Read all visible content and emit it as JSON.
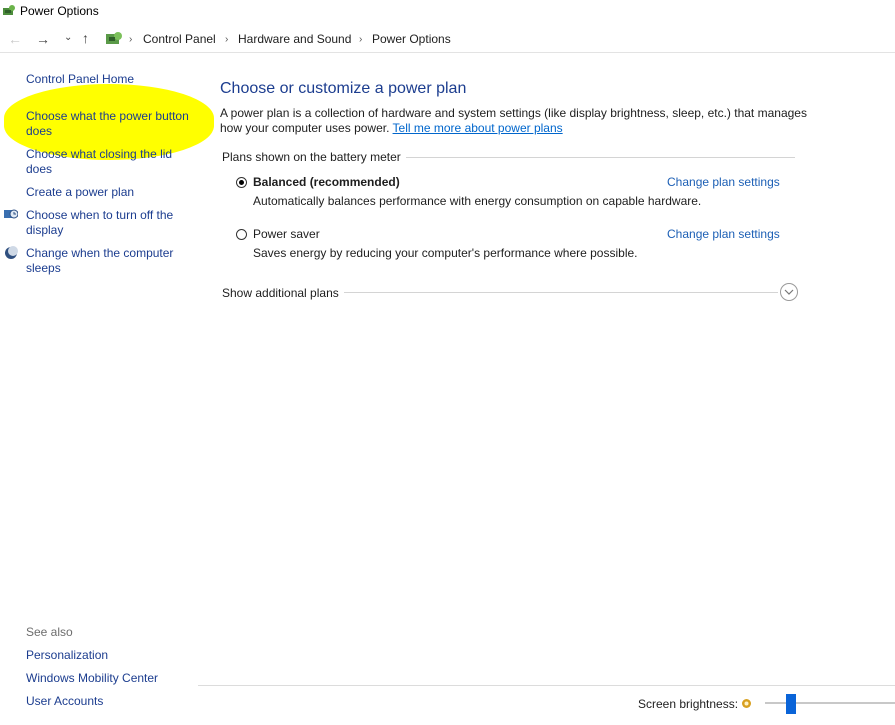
{
  "window": {
    "title": "Power Options"
  },
  "navbar": {
    "breadcrumbs": [
      "Control Panel",
      "Hardware and Sound",
      "Power Options"
    ],
    "sep": "›"
  },
  "left_pane": {
    "home": "Control Panel Home",
    "tasks": [
      {
        "label_line1": "Choose what the power button",
        "label_line2": "does"
      },
      {
        "label_line1": "Choose what closing the lid",
        "label_line2": "does"
      },
      {
        "label_line1": "Create a power plan",
        "label_line2": ""
      },
      {
        "label_line1": "Choose when to turn off the",
        "label_line2": "display"
      },
      {
        "label_line1": "Change when the computer",
        "label_line2": "sleeps"
      }
    ],
    "see_also": {
      "header": "See also",
      "links": [
        "Personalization",
        "Windows Mobility Center",
        "User Accounts"
      ]
    }
  },
  "main": {
    "title": "Choose or customize a power plan",
    "intro_text": "A power plan is a collection of hardware and system settings (like display brightness, sleep, etc.) that manages how your computer uses power. ",
    "intro_link": "Tell me more about power plans",
    "group_header": "Plans shown on the battery meter",
    "plans": [
      {
        "name": "Balanced (recommended)",
        "description": "Automatically balances performance with energy consumption on capable hardware.",
        "selected": true,
        "change_link": "Change plan settings"
      },
      {
        "name": "Power saver",
        "description": "Saves energy by reducing your computer's performance where possible.",
        "selected": false,
        "change_link": "Change plan settings"
      }
    ],
    "additional_plans": "Show additional plans"
  },
  "footer": {
    "brightness_label": "Screen brightness:",
    "brightness_level": 0.2
  },
  "colors": {
    "link": "#1c3d8f",
    "accent": "#0a64d8",
    "highlight": "#ffff00"
  }
}
